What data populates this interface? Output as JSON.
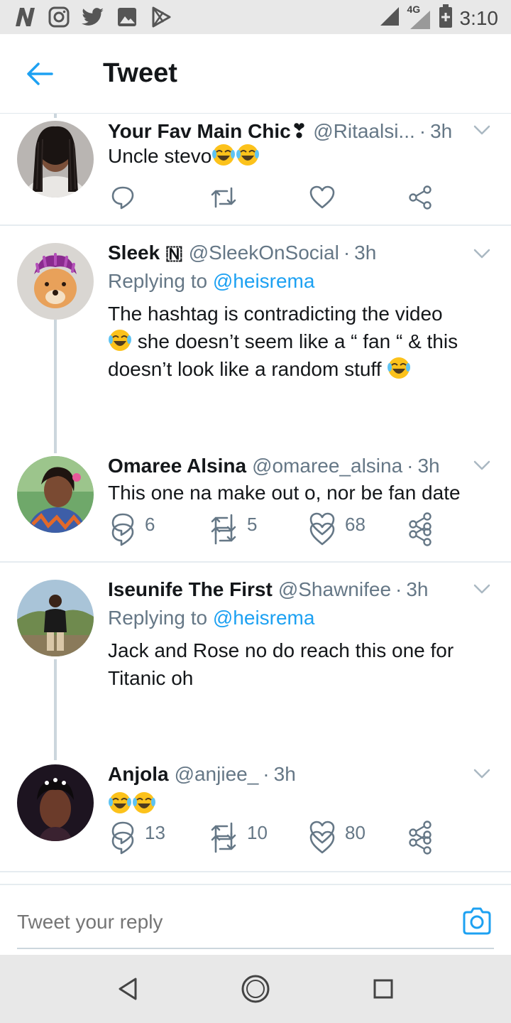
{
  "status_bar": {
    "time": "3:10",
    "network": "4G",
    "left_icons": [
      "n-app-icon",
      "instagram-icon",
      "twitter-icon",
      "gallery-icon",
      "play-store-icon"
    ]
  },
  "header": {
    "title": "Tweet"
  },
  "tweets": [
    {
      "name": "Your Fav Main Chic❣",
      "handle": "@Ritaalsi...",
      "time": "3h",
      "text": "Uncle stevo",
      "emoji_count": 2,
      "replies": "",
      "retweets": "",
      "likes": ""
    },
    {
      "name": "Sleek 🇳",
      "handle": "@SleekOnSocial",
      "time": "3h",
      "replying_label": "Replying to",
      "replying_to": "@heisrema",
      "text_line1": "The hashtag is contradicting the video",
      "text_line2": " she doesn’t seem like a “ fan “ & this",
      "text_line3": "doesn’t look like a random stuff ",
      "replies": "6",
      "retweets": "5",
      "likes": "68"
    },
    {
      "name": "Omaree Alsina",
      "handle": "@omaree_alsina",
      "time": "3h",
      "text": "This one na make out o, nor be fan date",
      "replies": "",
      "retweets": "",
      "likes": ""
    },
    {
      "name": "Iseunife The First",
      "handle": "@Shawnifee",
      "time": "3h",
      "replying_label": "Replying to",
      "replying_to": "@heisrema",
      "text": "Jack and Rose no do reach this one for Titanic oh",
      "replies": "13",
      "retweets": "10",
      "likes": "80"
    },
    {
      "name": "Anjola",
      "handle": "@anjiee_",
      "time": "3h",
      "emoji_count": 2,
      "replies": "",
      "retweets": "",
      "likes": ""
    }
  ],
  "composer": {
    "placeholder": "Tweet your reply"
  },
  "colors": {
    "accent": "#1da1f2",
    "secondary_text": "#657786",
    "primary_text": "#14171a",
    "icon": "#657786"
  }
}
